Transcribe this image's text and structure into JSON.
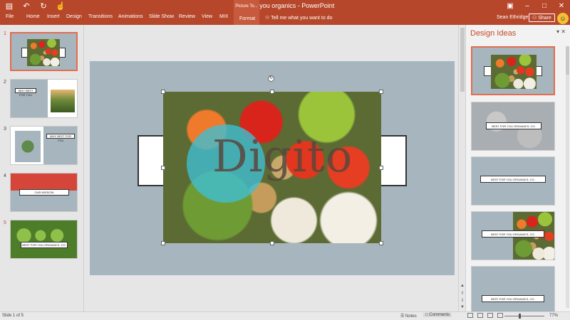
{
  "window": {
    "document_title": "Best for you organics - PowerPoint",
    "context_tab_group": "Picture To...",
    "quick_access": [
      "save-icon",
      "undo-icon",
      "redo-icon",
      "touch-mode-icon"
    ],
    "controls": [
      "minimize-icon",
      "restore-icon",
      "close-icon"
    ]
  },
  "ribbon": {
    "tabs": [
      "File",
      "Home",
      "Insert",
      "Design",
      "Transitions",
      "Animations",
      "Slide Show",
      "Review",
      "View",
      "MIX"
    ],
    "active_context_tab": "Format",
    "tell_me": "Tell me what you want to do",
    "user": "Sean Ethridge",
    "share": "Share"
  },
  "thumbnails": [
    {
      "number": "1",
      "selected": true
    },
    {
      "number": "2",
      "caption": "WHY BEST FOR YOU",
      "selected": false
    },
    {
      "number": "3",
      "caption": "WHY BEST FOR YOU",
      "selected": false
    },
    {
      "number": "4",
      "caption": "OUR MISSION",
      "selected": false
    },
    {
      "number": "5",
      "caption": "BEST FOR YOU ORGANICS, CO.",
      "selected": false
    }
  ],
  "slide": {
    "watermark_text": "Digito"
  },
  "design_ideas": {
    "title": "Design Ideas",
    "items": [
      {
        "label": "",
        "selected": true
      },
      {
        "label": "BEST FOR YOU ORGANICS, CO.",
        "selected": false
      },
      {
        "label": "BEST FOR YOU ORGANICS, CO.",
        "selected": false
      },
      {
        "label": "BEST FOR YOU ORGANICS, CO.",
        "selected": false
      },
      {
        "label": "BEST FOR YOU ORGANICS, CO.",
        "selected": false
      }
    ]
  },
  "status": {
    "slide_info": "Slide 1 of 5",
    "notes": "Notes",
    "comments": "Comments",
    "zoom": "77%"
  },
  "colors": {
    "accent": "#b7472a",
    "slide_background": "#a7b6be",
    "selection": "#e46c4f"
  }
}
